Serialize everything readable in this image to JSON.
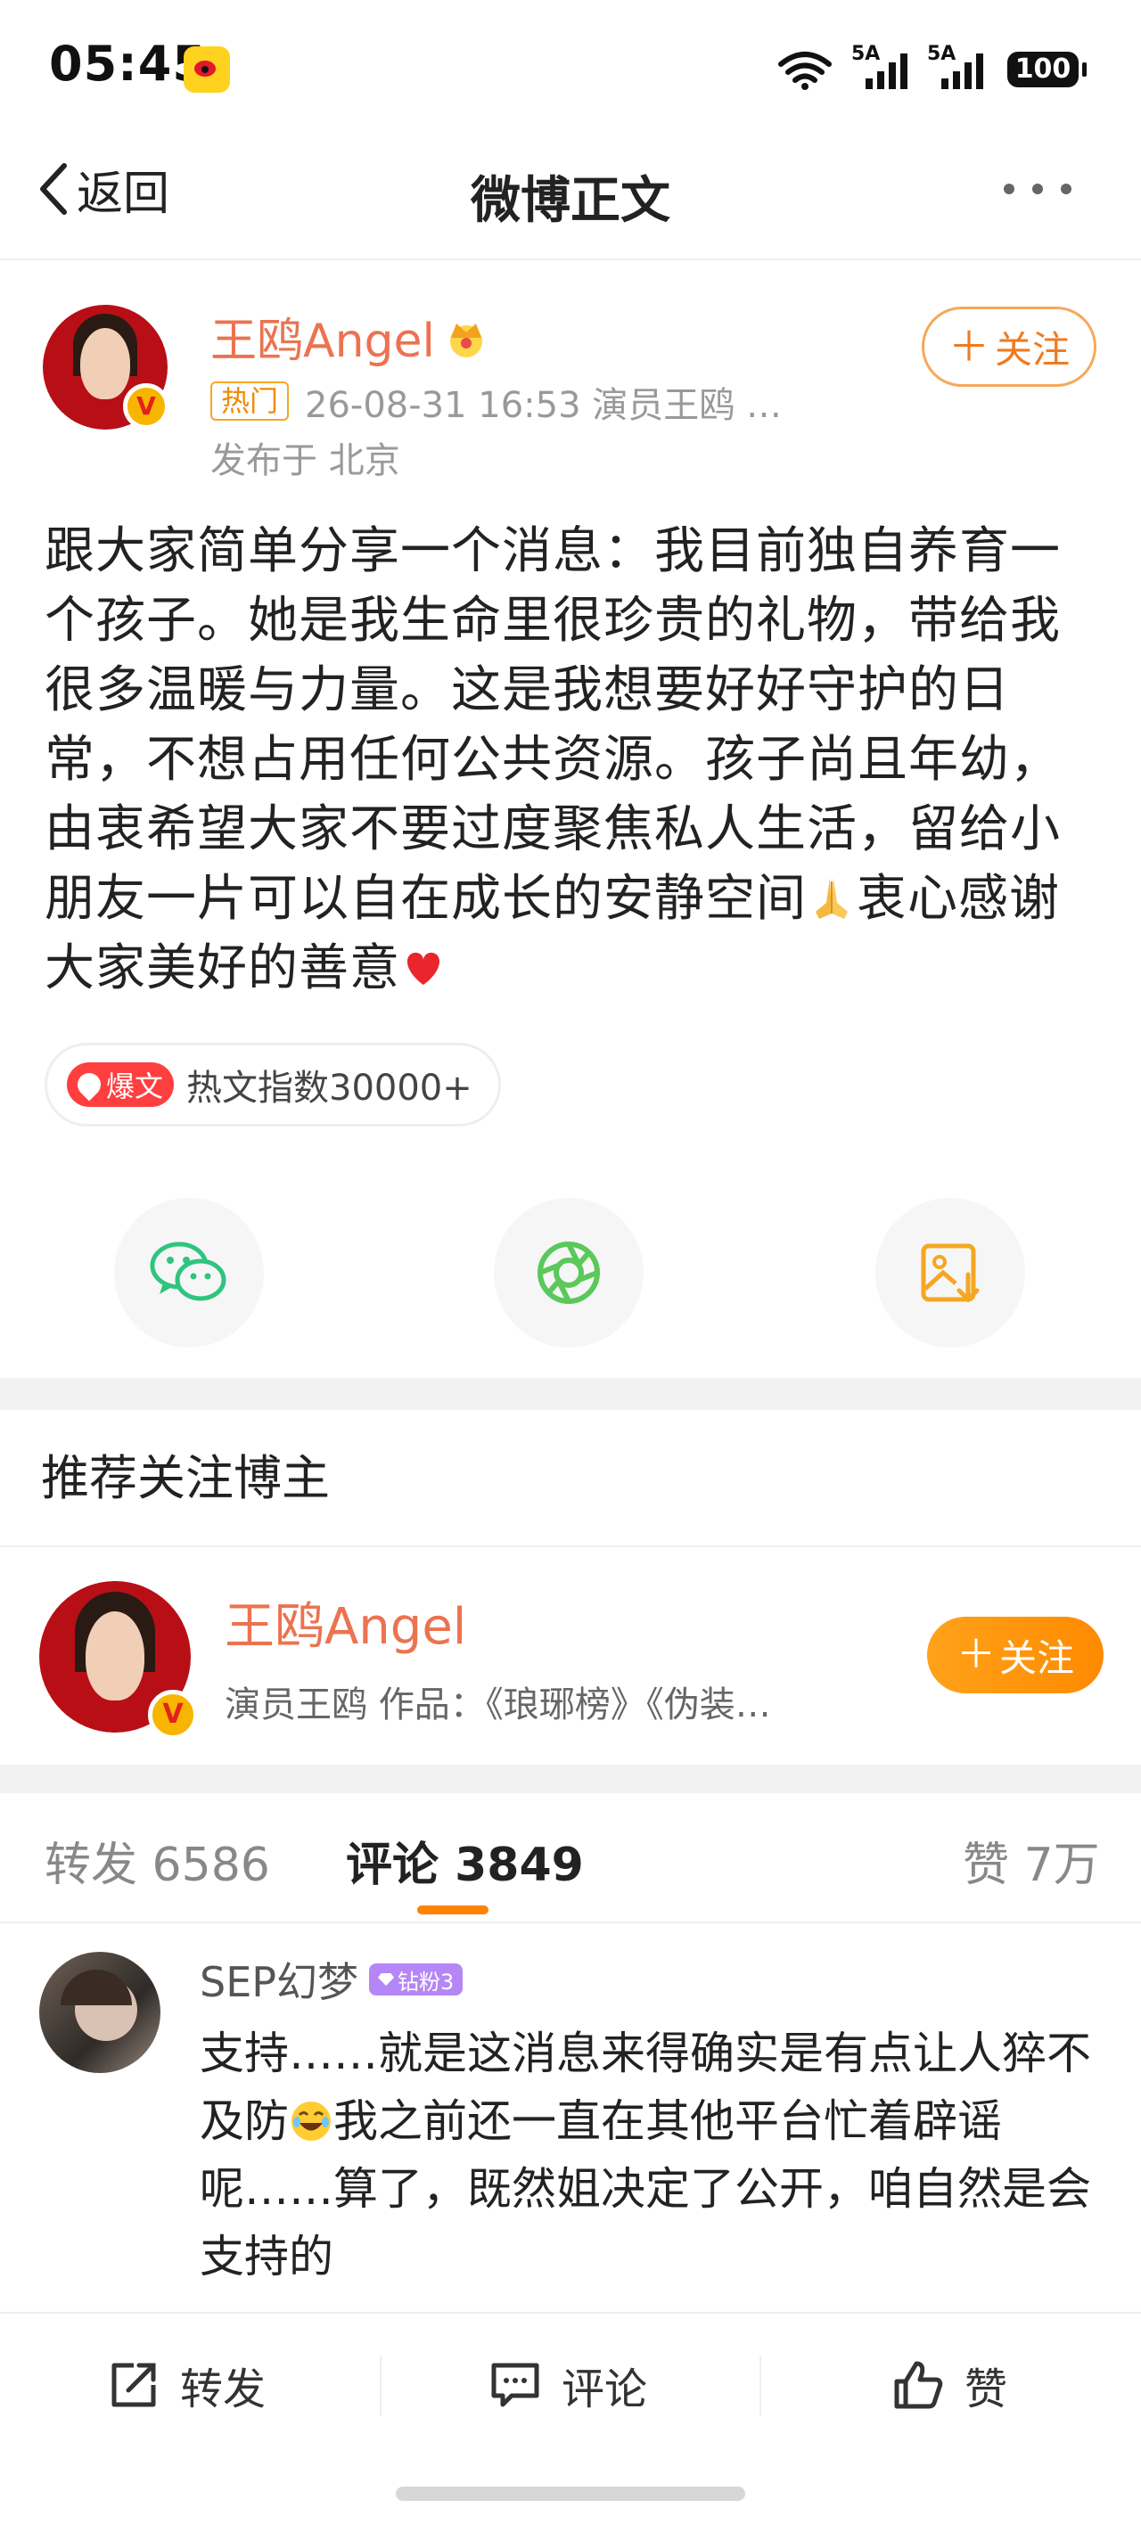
{
  "status_bar": {
    "time": "05:45",
    "network1": "5A",
    "network2": "5A",
    "wifi_label": "6",
    "battery": "100"
  },
  "nav": {
    "back_label": "返回",
    "title": "微博正文"
  },
  "post": {
    "author": "王鸥Angel",
    "hot_tag": "热门",
    "meta": "26-08-31 16:53  演员王鸥 …",
    "location": "发布于 北京",
    "follow_label": "关注",
    "text_part1": "跟大家简单分享一个消息：我目前独自养育一个孩子。她是我生命里很珍贵的礼物，带给我很多温暖与力量。这是我想要好好守护的日常，不想占用任何公共资源。孩子尚且年幼，由衷希望大家不要过度聚焦私人生活，留给小朋友一片可以自在成长的安静空间",
    "text_part2": "衷心感谢大家美好的善意",
    "hot_badge": "爆文",
    "hot_index": "热文指数30000+"
  },
  "share": {
    "icons": [
      "wechat-icon",
      "moments-icon",
      "save-image-icon"
    ]
  },
  "recommend": {
    "title": "推荐关注博主",
    "name": "王鸥Angel",
    "desc": "演员王鸥 作品：《琅琊榜》《伪装…",
    "follow_label": "关注"
  },
  "tabs": {
    "repost": "转发 6586",
    "comment": "评论 3849",
    "like": "赞 7万"
  },
  "comment": {
    "user": "SEP幻梦",
    "badge": "钻粉3",
    "text_part1": "支持……就是这消息来得确实是有点让人猝不及防",
    "text_part2": "我之前还一直在其他平台忙着辟谣呢……算了，既然姐决定了公开，咱自然是会支持的"
  },
  "bottom_bar": {
    "repost": "转发",
    "comment": "评论",
    "like": "赞"
  },
  "colors": {
    "accent_orange": "#ff8200",
    "name_orange": "#eb7350",
    "hot_red": "#ff3f3f"
  }
}
